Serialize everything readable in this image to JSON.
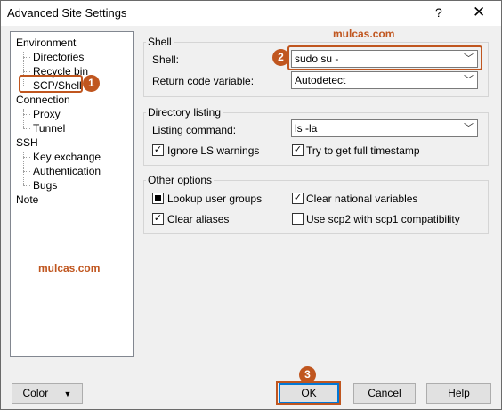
{
  "window": {
    "title": "Advanced Site Settings",
    "help_glyph": "?",
    "close_glyph": "✕"
  },
  "tree": {
    "items": [
      {
        "label": "Environment"
      },
      {
        "label": "Directories"
      },
      {
        "label": "Recycle bin"
      },
      {
        "label": "SCP/Shell"
      },
      {
        "label": "Connection"
      },
      {
        "label": "Proxy"
      },
      {
        "label": "Tunnel"
      },
      {
        "label": "SSH"
      },
      {
        "label": "Key exchange"
      },
      {
        "label": "Authentication"
      },
      {
        "label": "Bugs"
      },
      {
        "label": "Note"
      }
    ],
    "selected": "SCP/Shell"
  },
  "shell_group": {
    "title": "Shell",
    "shell_label": "Shell:",
    "shell_value": "sudo su -",
    "return_code_label": "Return code variable:",
    "return_code_value": "Autodetect"
  },
  "dir_group": {
    "title": "Directory listing",
    "listing_label": "Listing command:",
    "listing_value": "ls -la",
    "ignore_ls": "Ignore LS warnings",
    "full_timestamp": "Try to get full timestamp"
  },
  "other_group": {
    "title": "Other options",
    "lookup_groups": "Lookup user groups",
    "clear_national": "Clear national variables",
    "clear_aliases": "Clear aliases",
    "scp2_compat": "Use scp2 with scp1 compatibility"
  },
  "annotations": {
    "watermark": "mulcas.com",
    "badge1": "1",
    "badge2": "2",
    "badge3": "3"
  },
  "buttons": {
    "color": "Color",
    "ok": "OK",
    "cancel": "Cancel",
    "help": "Help"
  },
  "colors": {
    "accent": "#c0561f",
    "default_button_border": "#0078d7"
  }
}
